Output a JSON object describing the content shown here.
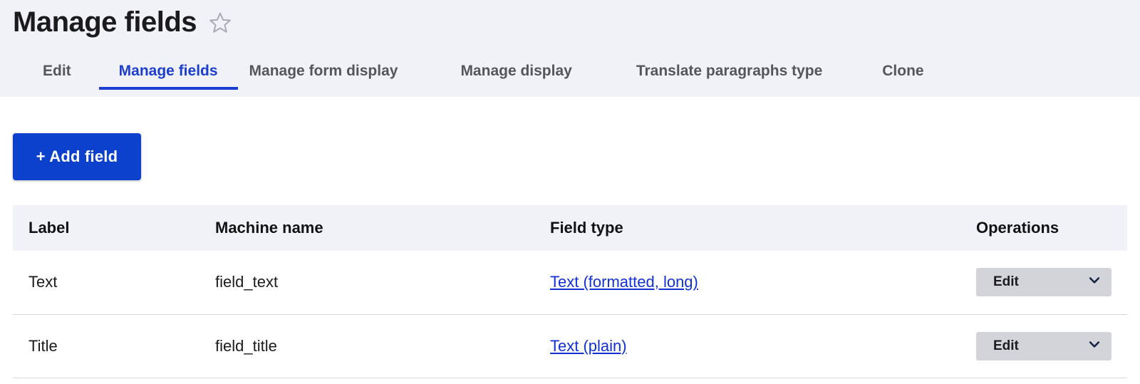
{
  "header": {
    "title": "Manage fields",
    "favorite_icon": "star-outline-icon"
  },
  "tabs": [
    {
      "label": "Edit",
      "active": false
    },
    {
      "label": "Manage fields",
      "active": true
    },
    {
      "label": "Manage form display",
      "active": false
    },
    {
      "label": "Manage display",
      "active": false
    },
    {
      "label": "Translate paragraphs type",
      "active": false
    },
    {
      "label": "Clone",
      "active": false
    }
  ],
  "toolbar": {
    "add_field_label": "+ Add field"
  },
  "table": {
    "columns": [
      "Label",
      "Machine name",
      "Field type",
      "Operations"
    ],
    "rows": [
      {
        "label": "Text",
        "machine_name": "field_text",
        "field_type": "Text (formatted, long)",
        "operation_label": "Edit",
        "operation_icon": "chevron-down-icon"
      },
      {
        "label": "Title",
        "machine_name": "field_title",
        "field_type": "Text (plain)",
        "operation_label": "Edit",
        "operation_icon": "chevron-down-icon"
      }
    ]
  },
  "colors": {
    "header_band": "#f0f2f7",
    "accent_blue": "#1b3ed1",
    "button_blue": "#0c41cd",
    "link_blue": "#1230d4",
    "dropdown_gray": "#d3d4d9",
    "divider": "#d8dade"
  }
}
